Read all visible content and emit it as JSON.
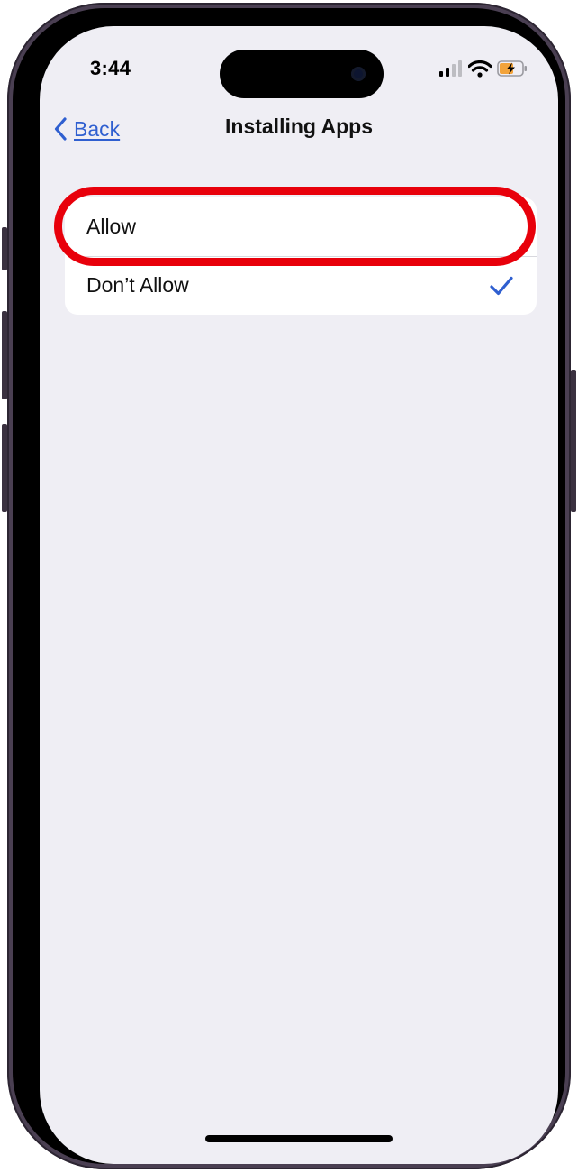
{
  "status_bar": {
    "time": "3:44",
    "signal_icon": "cellular-signal-icon",
    "wifi_icon": "wifi-icon",
    "battery_icon": "battery-charging-icon"
  },
  "nav": {
    "back_label": "Back",
    "title": "Installing Apps"
  },
  "options": [
    {
      "label": "Allow",
      "selected": false
    },
    {
      "label": "Don’t Allow",
      "selected": true
    }
  ],
  "colors": {
    "accent": "#2f5fd0",
    "highlight": "#e8000b",
    "background": "#efeef4",
    "battery_fill": "#f2a33a"
  }
}
